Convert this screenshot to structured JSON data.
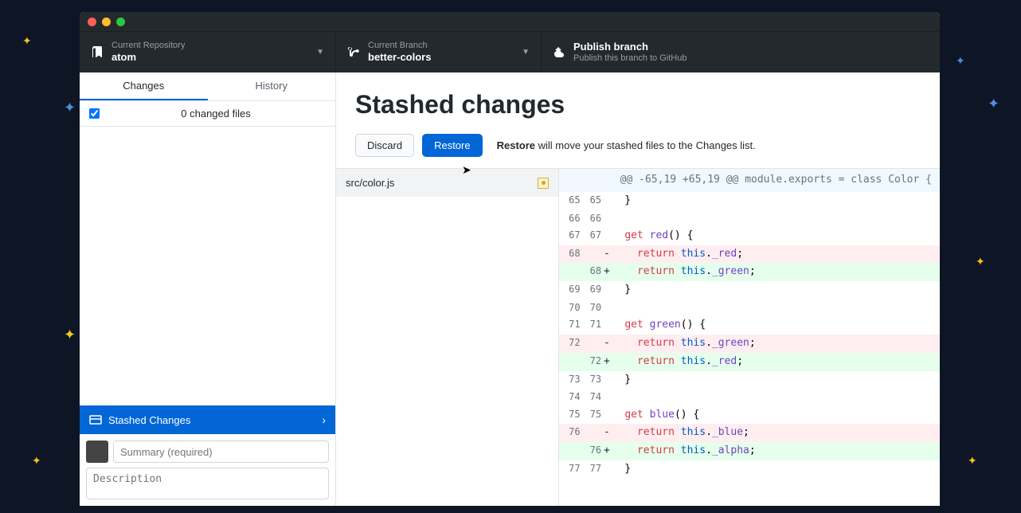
{
  "toolbar": {
    "repo_label": "Current Repository",
    "repo_value": "atom",
    "branch_label": "Current Branch",
    "branch_value": "better-colors",
    "publish_label": "Publish branch",
    "publish_value": "Publish this branch to GitHub"
  },
  "sidebar": {
    "tabs": {
      "changes": "Changes",
      "history": "History"
    },
    "file_count": "0 changed files",
    "stashed_label": "Stashed Changes",
    "summary_placeholder": "Summary (required)",
    "desc_placeholder": "Description"
  },
  "main": {
    "title": "Stashed changes",
    "discard": "Discard",
    "restore": "Restore",
    "hint_strong": "Restore",
    "hint_rest": " will move your stashed files to the Changes list.",
    "file": "src/color.js"
  },
  "diff": {
    "hunk": "@@ -65,19 +65,19 @@ module.exports = class Color {",
    "lines": [
      {
        "old": "65",
        "new": "65",
        "type": "ctx",
        "kind": "brace",
        "text": "}"
      },
      {
        "old": "66",
        "new": "66",
        "type": "ctx",
        "kind": "blank",
        "text": ""
      },
      {
        "old": "67",
        "new": "67",
        "type": "ctx",
        "kind": "get",
        "method": "red"
      },
      {
        "old": "68",
        "new": "",
        "type": "del",
        "kind": "return",
        "prop": "_red"
      },
      {
        "old": "",
        "new": "68",
        "type": "add",
        "kind": "return",
        "prop": "_green"
      },
      {
        "old": "69",
        "new": "69",
        "type": "ctx",
        "kind": "brace",
        "text": "}"
      },
      {
        "old": "70",
        "new": "70",
        "type": "ctx",
        "kind": "blank",
        "text": ""
      },
      {
        "old": "71",
        "new": "71",
        "type": "ctx",
        "kind": "get",
        "method": "green"
      },
      {
        "old": "72",
        "new": "",
        "type": "del",
        "kind": "return",
        "prop": "_green"
      },
      {
        "old": "",
        "new": "72",
        "type": "add",
        "kind": "return",
        "prop": "_red"
      },
      {
        "old": "73",
        "new": "73",
        "type": "ctx",
        "kind": "brace",
        "text": "}"
      },
      {
        "old": "74",
        "new": "74",
        "type": "ctx",
        "kind": "blank",
        "text": ""
      },
      {
        "old": "75",
        "new": "75",
        "type": "ctx",
        "kind": "get",
        "method": "blue"
      },
      {
        "old": "76",
        "new": "",
        "type": "del",
        "kind": "return",
        "prop": "_blue"
      },
      {
        "old": "",
        "new": "76",
        "type": "add",
        "kind": "return",
        "prop": "_alpha"
      },
      {
        "old": "77",
        "new": "77",
        "type": "ctx",
        "kind": "brace",
        "text": "}"
      }
    ]
  }
}
